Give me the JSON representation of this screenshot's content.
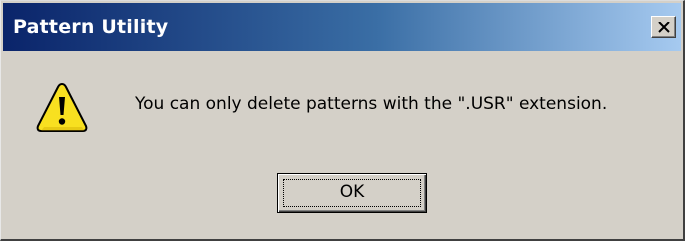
{
  "dialog": {
    "title": "Pattern Utility",
    "message": "You can only delete patterns with the \".USR\" extension.",
    "icon": "warning-icon",
    "ok_label": "OK",
    "close_icon": "close-icon"
  },
  "colors": {
    "titlebar_start": "#0a246a",
    "titlebar_end": "#a6caf0",
    "face": "#d4d0c8",
    "warning_yellow": "#f8e020"
  }
}
